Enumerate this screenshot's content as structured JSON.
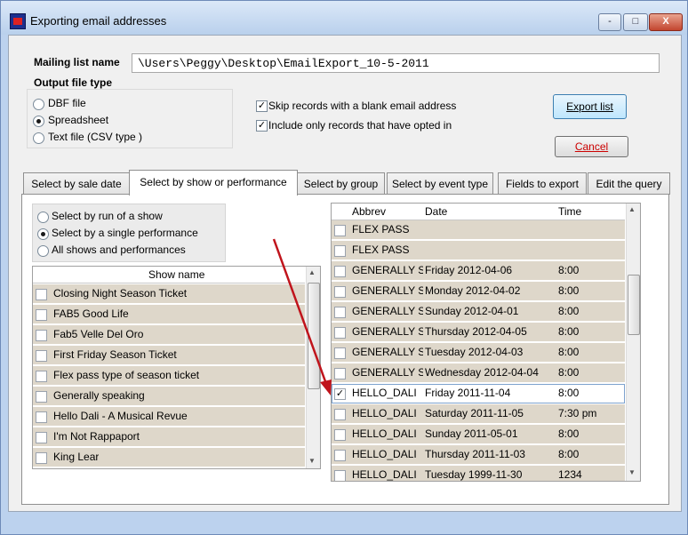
{
  "window": {
    "title": "Exporting email addresses",
    "controls": [
      "-",
      "□",
      "X"
    ]
  },
  "mailing": {
    "label": "Mailing list name",
    "value": "\\Users\\Peggy\\Desktop\\EmailExport_10-5-2011"
  },
  "output": {
    "label": "Output file type",
    "options": [
      {
        "label": "DBF file",
        "selected": false
      },
      {
        "label": "Spreadsheet",
        "selected": true
      },
      {
        "label": "Text file (CSV type )",
        "selected": false
      }
    ]
  },
  "options": [
    {
      "label": "Skip records with a blank email address",
      "checked": true
    },
    {
      "label": "Include only records that have opted in",
      "checked": true
    }
  ],
  "buttons": {
    "export": "Export list",
    "cancel": "Cancel"
  },
  "tabs": [
    {
      "label": "Select by sale date",
      "active": false
    },
    {
      "label": "Select by show or performance",
      "active": true
    },
    {
      "label": "Select by group",
      "active": false
    },
    {
      "label": "Select by event type",
      "active": false
    },
    {
      "label": "Fields to export",
      "active": false
    },
    {
      "label": "Edit the query",
      "active": false
    }
  ],
  "selection_mode": [
    {
      "label": "Select by run of a show",
      "selected": false
    },
    {
      "label": "Select by a single performance",
      "selected": true
    },
    {
      "label": "All shows and performances",
      "selected": false
    }
  ],
  "shows": {
    "header": "Show name",
    "rows": [
      "Closing Night Season Ticket",
      "FAB5 Good Life",
      "Fab5 Velle Del Oro",
      "First Friday Season Ticket",
      "Flex pass type of season ticket",
      "Generally speaking",
      "Hello Dali - A Musical Revue",
      "I'm Not Rappaport",
      "King Lear"
    ]
  },
  "performances": {
    "headers": [
      "Abbrev",
      "Date",
      "Time"
    ],
    "rows": [
      {
        "abbrev": "FLEX PASS",
        "date": "",
        "time": "",
        "checked": false
      },
      {
        "abbrev": "FLEX PASS",
        "date": "",
        "time": "",
        "checked": false
      },
      {
        "abbrev": "GENERALLY S",
        "date": "Friday 2012-04-06",
        "time": "8:00",
        "checked": false
      },
      {
        "abbrev": "GENERALLY S",
        "date": "Monday 2012-04-02",
        "time": "8:00",
        "checked": false
      },
      {
        "abbrev": "GENERALLY S",
        "date": "Sunday 2012-04-01",
        "time": "8:00",
        "checked": false
      },
      {
        "abbrev": "GENERALLY S",
        "date": "Thursday 2012-04-05",
        "time": "8:00",
        "checked": false
      },
      {
        "abbrev": "GENERALLY S",
        "date": "Tuesday 2012-04-03",
        "time": "8:00",
        "checked": false
      },
      {
        "abbrev": "GENERALLY S",
        "date": "Wednesday 2012-04-04",
        "time": "8:00",
        "checked": false
      },
      {
        "abbrev": "HELLO_DALI",
        "date": "Friday 2011-11-04",
        "time": "8:00",
        "checked": true
      },
      {
        "abbrev": "HELLO_DALI",
        "date": "Saturday 2011-11-05",
        "time": "7:30 pm",
        "checked": false
      },
      {
        "abbrev": "HELLO_DALI",
        "date": "Sunday 2011-05-01",
        "time": "8:00",
        "checked": false
      },
      {
        "abbrev": "HELLO_DALI",
        "date": "Thursday 2011-11-03",
        "time": "8:00",
        "checked": false
      },
      {
        "abbrev": "HELLO_DALI",
        "date": "Tuesday 1999-11-30",
        "time": "1234",
        "checked": false
      }
    ]
  },
  "colors": {
    "row_bg": "#ded7ca",
    "annotation_arrow": "#c0141c"
  },
  "icons": {
    "app": "app-icon",
    "check": "✓"
  }
}
